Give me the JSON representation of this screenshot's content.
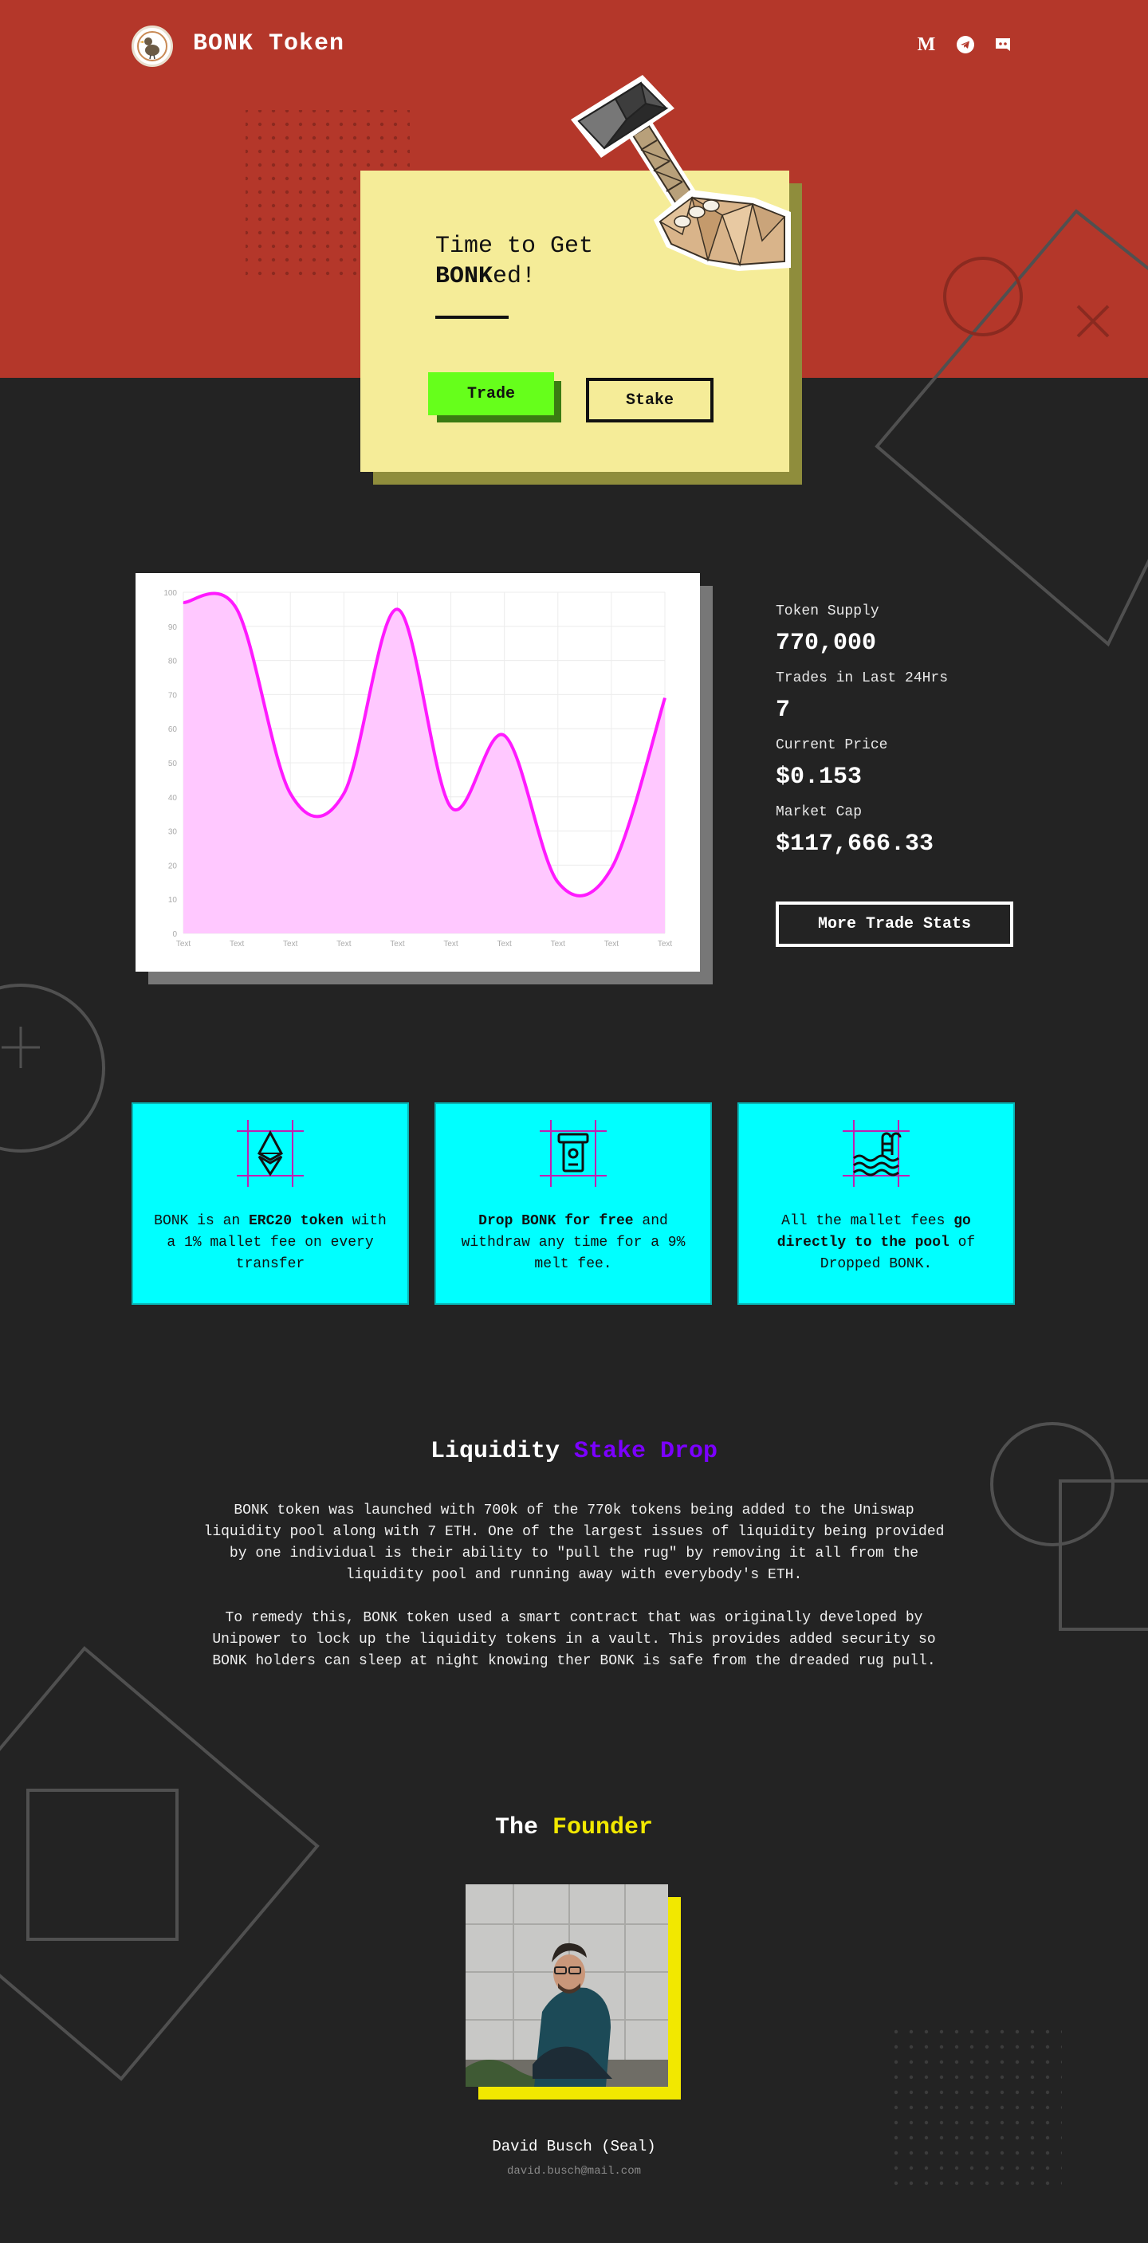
{
  "header": {
    "brand": "BONK Token",
    "logo_icon": "bird-logo-icon",
    "social_links": [
      {
        "icon": "medium-icon",
        "glyph": "M"
      },
      {
        "icon": "telegram-icon"
      },
      {
        "icon": "discord-icon"
      }
    ]
  },
  "hero": {
    "title_line1": "Time to Get",
    "title_bold": "BONK",
    "title_rest": "ed!",
    "trade_label": "Trade",
    "stake_label": "Stake",
    "illustration": "hammer-in-hand-icon"
  },
  "chart_data": {
    "type": "area",
    "x": [
      "Text",
      "Text",
      "Text",
      "Text",
      "Text",
      "Text",
      "Text",
      "Text",
      "Text",
      "Text"
    ],
    "values": [
      97,
      95,
      41,
      41,
      95,
      37,
      58,
      15,
      19,
      69
    ],
    "yticks": [
      0,
      10,
      20,
      30,
      40,
      50,
      60,
      70,
      80,
      90,
      100
    ],
    "ylim": [
      0,
      100
    ],
    "grid": true,
    "colors": {
      "line": "#ff1aff",
      "fill": "#ffc8ff"
    }
  },
  "stats": {
    "supply_label": "Token Supply",
    "supply_value": "770,000",
    "trades_label": "Trades in Last 24Hrs",
    "trades_value": "7",
    "price_label": "Current Price",
    "price_value": "$0.153",
    "cap_label": "Market Cap",
    "cap_value": "$117,666.33",
    "more_label": "More Trade Stats"
  },
  "features": [
    {
      "icon": "ethereum-icon",
      "pre": "BONK is an ",
      "bold": "ERC20 token",
      "post": " with a 1% mallet fee on every transfer"
    },
    {
      "icon": "atm-withdraw-icon",
      "pre": "",
      "bold": "Drop BONK for free",
      "post": " and withdraw any time for a 9% melt fee."
    },
    {
      "icon": "pool-icon",
      "pre": "All the mallet fees ",
      "bold": "go directly to the pool",
      "post": " of Dropped BONK."
    }
  ],
  "liquidity": {
    "title_a": "Liquidity ",
    "title_b": "Stake Drop",
    "para1": "BONK token was launched with 700k of the 770k tokens being added to the Uniswap liquidity pool along with 7 ETH. One of the largest issues of liquidity being provided by one individual is their ability to \"pull the rug\" by removing it all from the liquidity pool and running away with everybody's ETH.",
    "para2": "To remedy this, BONK token used a smart contract that was originally developed by Unipower to lock up the liquidity tokens in a vault. This provides added security so BONK holders can sleep at night knowing ther BONK is safe from the dreaded rug pull."
  },
  "founder": {
    "title_a": "The ",
    "title_b": "Founder",
    "name": "David Busch (Seal)",
    "email": "david.busch@mail.com"
  },
  "colors": {
    "hero_red": "#b4372a",
    "background": "#232323",
    "card_yellow": "#f5ec98",
    "trade_green": "#66ff1b",
    "feature_cyan": "#00ffff",
    "accent_purple": "#7b00ff",
    "accent_yellow": "#f2e800",
    "chart_magenta": "#ff1aff"
  }
}
